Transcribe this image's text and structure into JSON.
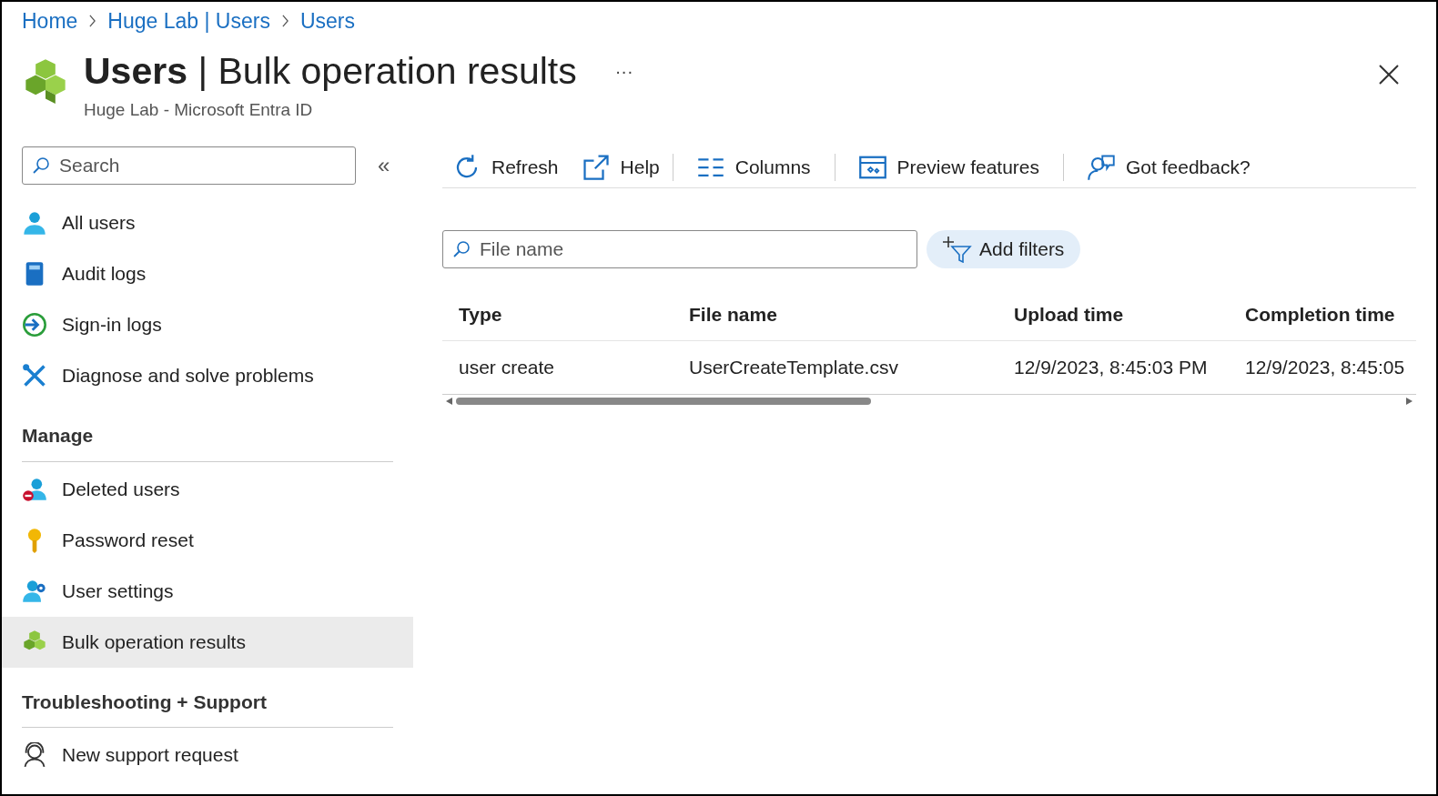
{
  "breadcrumbs": [
    "Home",
    "Huge Lab | Users",
    "Users"
  ],
  "header": {
    "title": "**Users** | Bulk operation results",
    "more": "···",
    "subtitle": "Huge Lab - Microsoft Entra ID"
  },
  "sidebar": {
    "search": {
      "placeholder": "Search"
    },
    "collapse": "«",
    "sections": [
      {
        "items": [
          {
            "label": "All users",
            "selected": false
          },
          {
            "label": "Audit logs",
            "selected": false
          },
          {
            "label": "Sign-in logs",
            "selected": false
          },
          {
            "label": "Diagnose and solve problems",
            "selected": false
          }
        ]
      },
      {
        "heading": "Manage",
        "items": [
          {
            "label": "Deleted users",
            "selected": false
          },
          {
            "label": "Password reset",
            "selected": false
          },
          {
            "label": "User settings",
            "selected": false
          },
          {
            "label": "Bulk operation results",
            "selected": true
          }
        ]
      },
      {
        "heading": "Troubleshooting + Support",
        "items": [
          {
            "label": "New support request",
            "selected": false
          }
        ]
      }
    ]
  },
  "toolbar": [
    {
      "label": "Refresh"
    },
    {
      "label": "Help"
    },
    {
      "label": "Columns"
    },
    {
      "label": "Preview features"
    },
    {
      "label": "Got feedback?"
    }
  ],
  "filter": {
    "placeholder": "File name",
    "add_filters": "Add filters"
  },
  "table": {
    "columns": [
      "Type",
      "File name",
      "Upload time",
      "Completion time"
    ],
    "rows": [
      [
        "user create",
        "UserCreateTemplate.csv",
        "12/9/2023, 8:45:03 PM",
        "12/9/2023, 8:45:05"
      ]
    ]
  }
}
